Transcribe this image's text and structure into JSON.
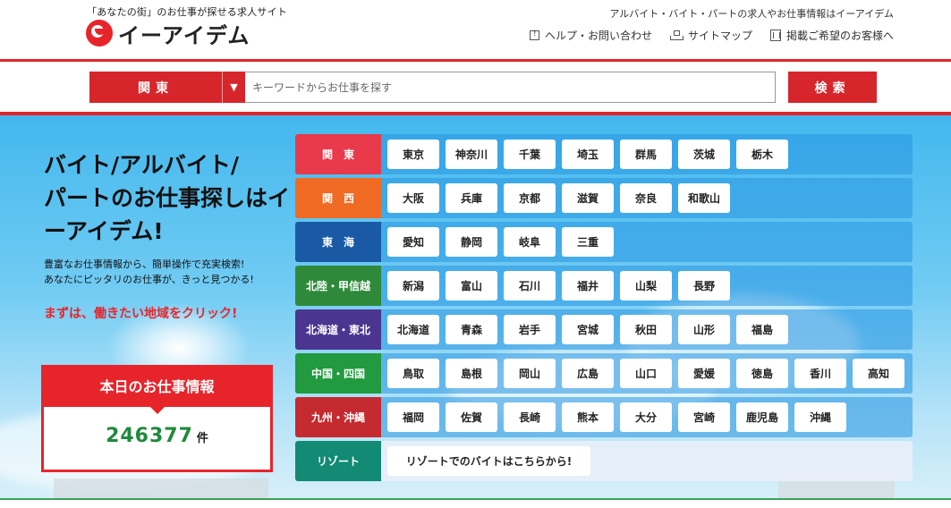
{
  "header": {
    "catchphrase": "「あなたの街」のお仕事が探せる求人サイト",
    "logo_text": "イーアイデム",
    "tagline": "アルバイト・バイト・パートの求人やお仕事情報はイーアイデム",
    "links": [
      {
        "label": "ヘルプ・お問い合わせ",
        "icon": "help-icon"
      },
      {
        "label": "サイトマップ",
        "icon": "sitemap-icon"
      },
      {
        "label": "掲載ご希望のお客様へ",
        "icon": "building-icon"
      }
    ]
  },
  "search": {
    "region_label": "関東",
    "arrow": "▼",
    "placeholder": "キーワードからお仕事を探す",
    "button_label": "検索"
  },
  "hero": {
    "title_line1": "バイト/アルバイト/",
    "title_line2": "パートのお仕事探しはイ",
    "title_line3": "ーアイデム!",
    "desc_line1": "豊富なお仕事情報から、簡単操作で充実検索!",
    "desc_line2": "あなたにピッタリのお仕事が、きっと見つかる!",
    "cta": "まずは、働きたい地域をクリック!"
  },
  "jobs_today": {
    "heading": "本日のお仕事情報",
    "count": "246377",
    "unit": "件"
  },
  "regions": [
    {
      "label": "関　東",
      "color": "#e83a4b",
      "prefs": [
        "東京",
        "神奈川",
        "千葉",
        "埼玉",
        "群馬",
        "茨城",
        "栃木"
      ]
    },
    {
      "label": "関　西",
      "color": "#f06a24",
      "prefs": [
        "大阪",
        "兵庫",
        "京都",
        "滋賀",
        "奈良",
        "和歌山"
      ]
    },
    {
      "label": "東　海",
      "color": "#1a5aa5",
      "prefs": [
        "愛知",
        "静岡",
        "岐阜",
        "三重"
      ]
    },
    {
      "label": "北陸・甲信越",
      "color": "#2e8a3a",
      "prefs": [
        "新潟",
        "富山",
        "石川",
        "福井",
        "山梨",
        "長野"
      ]
    },
    {
      "label": "北海道・東北",
      "color": "#4b3590",
      "prefs": [
        "北海道",
        "青森",
        "岩手",
        "宮城",
        "秋田",
        "山形",
        "福島"
      ]
    },
    {
      "label": "中国・四国",
      "color": "#229a3f",
      "prefs": [
        "鳥取",
        "島根",
        "岡山",
        "広島",
        "山口",
        "愛媛",
        "徳島",
        "香川",
        "高知"
      ]
    },
    {
      "label": "九州・沖縄",
      "color": "#c42a2f",
      "prefs": [
        "福岡",
        "佐賀",
        "長崎",
        "熊本",
        "大分",
        "宮崎",
        "鹿児島",
        "沖縄"
      ]
    }
  ],
  "resort": {
    "label": "リゾート",
    "color": "#128a74",
    "link": "リゾートでのバイトはこちらから!"
  }
}
